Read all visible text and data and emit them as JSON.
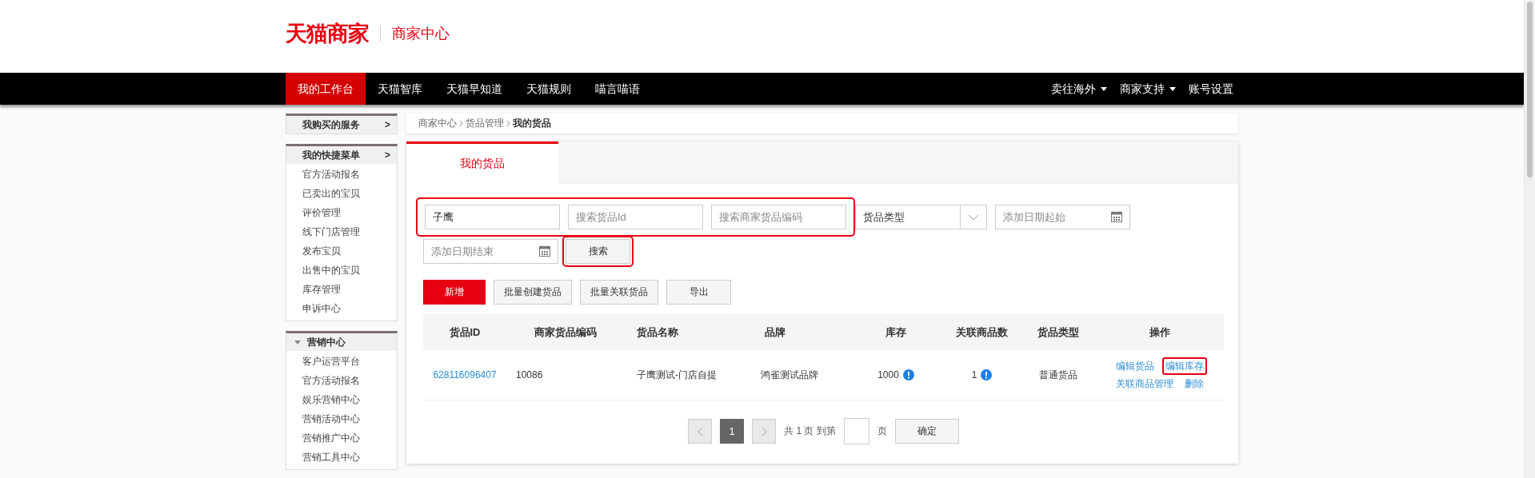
{
  "header": {
    "logo": "天猫商家",
    "subtitle": "商家中心"
  },
  "nav": {
    "left": [
      {
        "label": "我的工作台",
        "selected": true
      },
      {
        "label": "天猫智库",
        "selected": false
      },
      {
        "label": "天猫早知道",
        "selected": false
      },
      {
        "label": "天猫规则",
        "selected": false
      },
      {
        "label": "喵言喵语",
        "selected": false
      }
    ],
    "right": [
      {
        "label": "卖往海外",
        "has_menu": true
      },
      {
        "label": "商家支持",
        "has_menu": true
      },
      {
        "label": "账号设置",
        "has_menu": false
      }
    ]
  },
  "sidebar": [
    {
      "title": "我购买的服务",
      "kind": "link",
      "arrow": ">"
    },
    {
      "title": "我的快捷菜单",
      "kind": "link",
      "arrow": ">",
      "items": [
        "官方活动报名",
        "已卖出的宝贝",
        "评价管理",
        "线下门店管理",
        "发布宝贝",
        "出售中的宝贝",
        "库存管理",
        "申诉中心"
      ]
    },
    {
      "title": "营销中心",
      "kind": "folder",
      "expanded": true,
      "items": [
        "客户运营平台",
        "官方活动报名",
        "娱乐营销中心",
        "营销活动中心",
        "营销推广中心",
        "营销工具中心"
      ]
    }
  ],
  "breadcrumb": [
    "商家中心",
    "货品管理",
    "我的货品"
  ],
  "tabs": [
    {
      "label": "我的货品",
      "selected": true
    }
  ],
  "filters": {
    "highlight_frame": true,
    "fields": [
      {
        "kind": "text",
        "value": "子鹰"
      },
      {
        "kind": "text",
        "placeholder": "搜索货品Id"
      },
      {
        "kind": "text",
        "placeholder": "搜索商家货品编码"
      },
      {
        "kind": "select",
        "value": "货品类型"
      },
      {
        "kind": "date",
        "placeholder": "添加日期起始"
      },
      {
        "kind": "date",
        "placeholder": "添加日期结束"
      }
    ],
    "search_button": {
      "label": "搜索",
      "highlighted": true
    }
  },
  "actions": [
    {
      "label": "新增",
      "primary": true
    },
    {
      "label": "批量创建货品",
      "primary": false
    },
    {
      "label": "批量关联货品",
      "primary": false
    },
    {
      "label": "导出",
      "primary": false
    }
  ],
  "table": {
    "columns": [
      "货品ID",
      "商家货品编码",
      "货品名称",
      "品牌",
      "库存",
      "关联商品数",
      "货品类型",
      "操作"
    ],
    "rows": [
      {
        "id": "628116096407",
        "code": "10086",
        "name": "子鹰测试-门店自提",
        "brand": "鸿雀测试品牌",
        "stock": "1000",
        "linked": "1",
        "type": "普通货品",
        "operations": [
          {
            "label": "编辑货品",
            "highlighted": false
          },
          {
            "label": "编辑库存",
            "highlighted": true
          },
          {
            "label": "关联商品管理",
            "highlighted": false
          },
          {
            "label": "删除",
            "highlighted": false
          }
        ]
      }
    ]
  },
  "pagination": {
    "pages": [
      {
        "label": "1",
        "selected": true
      }
    ],
    "total_text": "共 1 页 到第",
    "page_unit": "页",
    "confirm": "确定"
  }
}
